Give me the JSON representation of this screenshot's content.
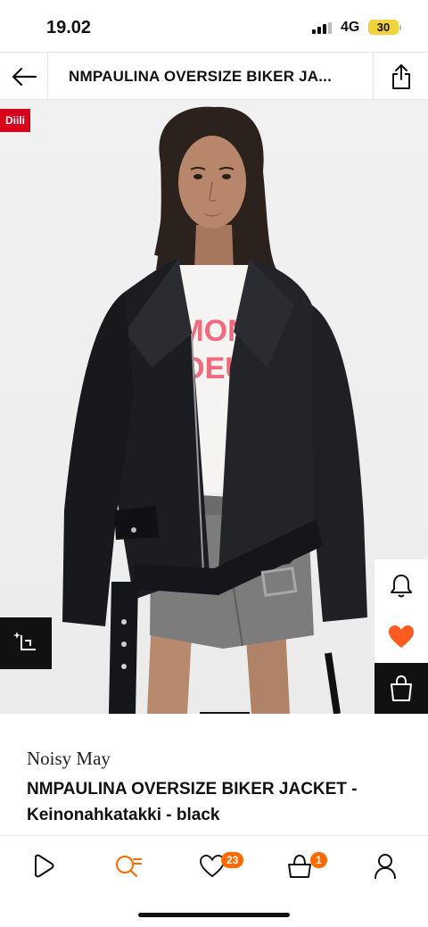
{
  "status_bar": {
    "time": "19.02",
    "network": "4G",
    "battery": "30"
  },
  "header": {
    "title": "NMPAULINA OVERSIZE BIKER JA..."
  },
  "image": {
    "deal_badge": "Diili",
    "shirt_graphic": [
      "MON",
      "COEUR"
    ]
  },
  "product": {
    "brand": "Noisy May",
    "name": "NMPAULINA OVERSIZE BIKER JACKET - Keinonahkatakki - black"
  },
  "nav": {
    "wishlist_count": "23",
    "bag_count": "1"
  },
  "colors": {
    "accent": "#ff6900",
    "deal": "#d9001b",
    "wishlist_heart": "#ff5a1f"
  }
}
